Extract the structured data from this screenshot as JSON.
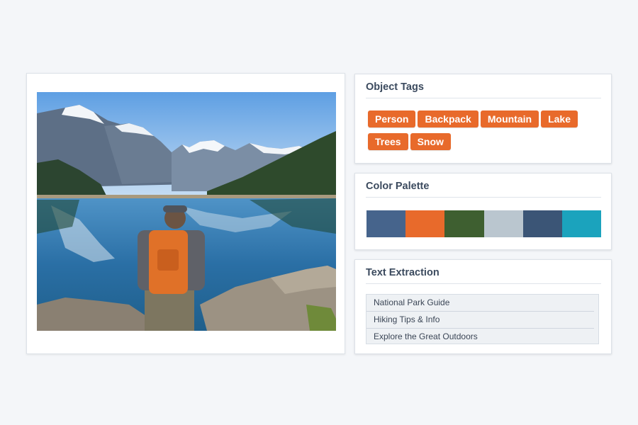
{
  "object_tags": {
    "title": "Object Tags",
    "tags": [
      "Person",
      "Backpack",
      "Mountain",
      "Lake",
      "Trees",
      "Snow"
    ]
  },
  "color_palette": {
    "title": "Color Palette",
    "swatches": [
      {
        "color": "#46648c"
      },
      {
        "color": "#e86a2b"
      },
      {
        "color": "#3e5f30"
      },
      {
        "color": "#bac6cf"
      },
      {
        "color": "#3b5576"
      },
      {
        "color": "#1ba3bd"
      }
    ]
  },
  "text_extraction": {
    "title": "Text Extraction",
    "lines": [
      "National Park Guide",
      "Hiking Tips & Info",
      "Explore the Great Outdoors"
    ]
  },
  "colors": {
    "accent": "#e86a2b",
    "background": "#f4f6f9",
    "panel": "#ffffff"
  }
}
